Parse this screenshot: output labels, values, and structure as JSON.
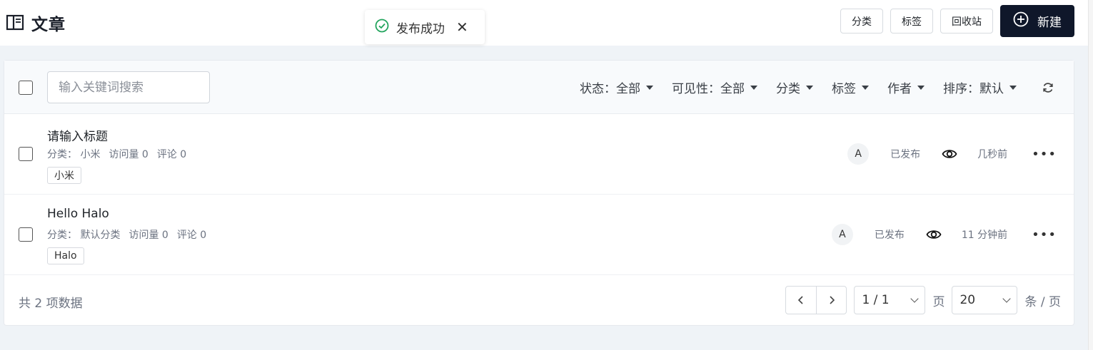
{
  "header": {
    "title": "文章",
    "buttons": {
      "category": "分类",
      "tag": "标签",
      "recycle": "回收站",
      "new": "新建"
    }
  },
  "toast": {
    "message": "发布成功"
  },
  "filters": {
    "search_placeholder": "输入关键词搜索",
    "status": "状态：全部",
    "visibility": "可见性：全部",
    "category": "分类",
    "tag": "标签",
    "author": "作者",
    "sort": "排序：默认"
  },
  "posts": [
    {
      "title": "请输入标题",
      "category": "分类：  小米",
      "views": "访问量 0",
      "comments": "评论 0",
      "tag": "小米",
      "author_initial": "A",
      "status": "已发布",
      "time": "几秒前"
    },
    {
      "title": "Hello Halo",
      "category": "分类：  默认分类",
      "views": "访问量 0",
      "comments": "评论 0",
      "tag": "Halo",
      "author_initial": "A",
      "status": "已发布",
      "time": "11 分钟前"
    }
  ],
  "footer": {
    "total": "共 2 项数据",
    "page": "1 / 1",
    "page_unit": "页",
    "page_size": "20",
    "size_unit": "条 / 页"
  }
}
